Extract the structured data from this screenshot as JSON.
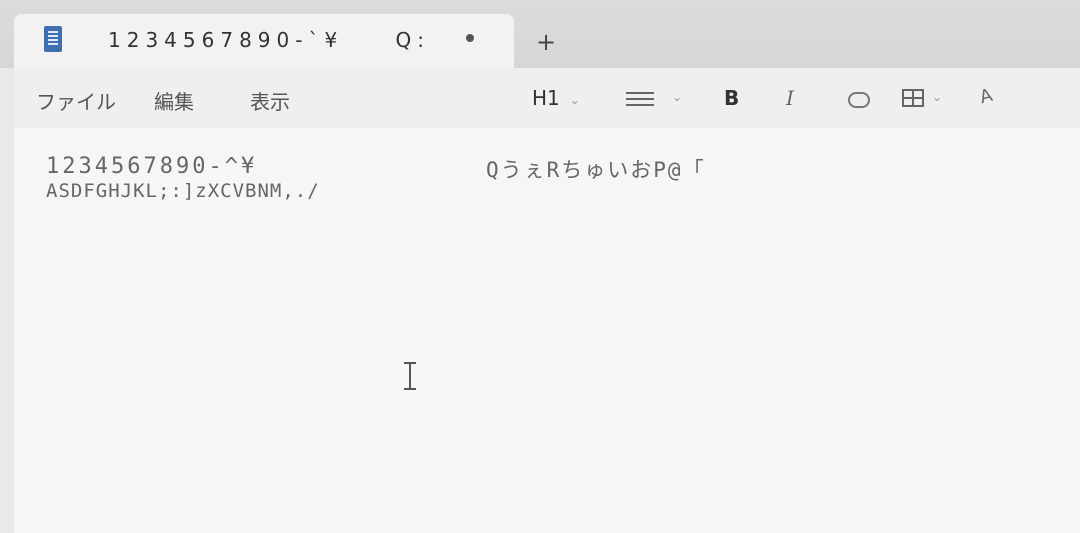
{
  "tab": {
    "title": "1234567890-`¥",
    "title_suffix": "Q:",
    "new_tab": "+",
    "icon": "notepad-icon"
  },
  "menu": {
    "file": "ファイル",
    "edit": "編集",
    "view": "表示"
  },
  "toolbar": {
    "heading": "H1",
    "bold": "B",
    "italic": "I",
    "list_icon": "bulleted-list-icon",
    "link_icon": "link-icon",
    "table_icon": "table-icon",
    "clear_format": "A"
  },
  "document": {
    "line1": "1234567890-^¥",
    "line1_right": "QうぇRちゅいおP@「",
    "line2": "ASDFGHJKL;:]zXCVBNM,./"
  }
}
